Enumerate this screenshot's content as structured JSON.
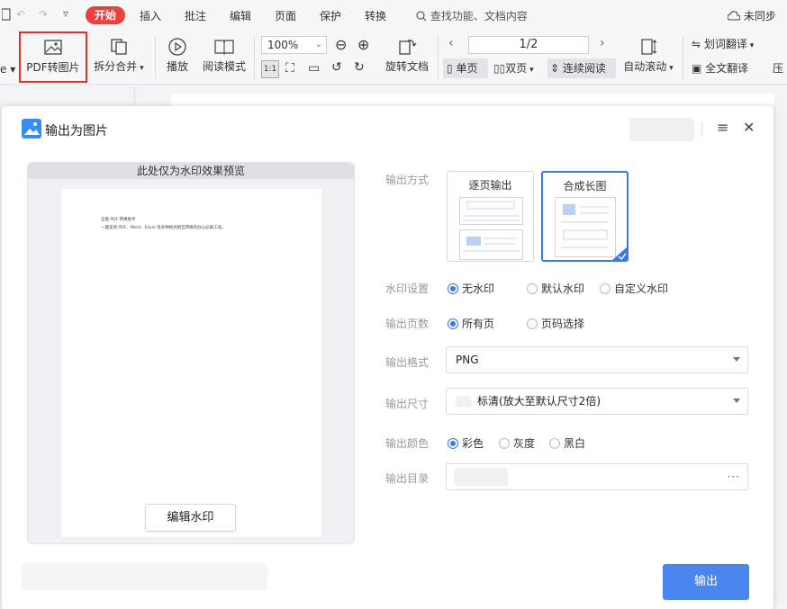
{
  "menubar": {
    "items": [
      "开始",
      "插入",
      "批注",
      "编辑",
      "页面",
      "保护",
      "转换"
    ],
    "search_placeholder": "查找功能、文档内容",
    "sync_label": "未同步"
  },
  "toolbar": {
    "pdf_to_image": "PDF转图片",
    "split_merge": "拆分合并",
    "play": "播放",
    "read_mode": "阅读模式",
    "zoom": "100%",
    "rotate_doc": "旋转文档",
    "page_indicator": "1/2",
    "single_page": "单页",
    "double_page": "双页",
    "continuous": "连续阅读",
    "auto_scroll": "自动滚动",
    "word_translate": "划词翻译",
    "full_translate": "全文翻译",
    "overflow": "压"
  },
  "dialog": {
    "title": "输出为图片",
    "preview_header": "此处仅为水印效果预览",
    "preview_line1": "全能 PDF 转换助手",
    "preview_line2": "一键支持 PDF、Word、Excel 等多种格式相互转换的办公必备工具。",
    "edit_watermark": "编辑水印",
    "output_mode_label": "输出方式",
    "mode_per_page": "逐页输出",
    "mode_long_image": "合成长图",
    "watermark_label": "水印设置",
    "wm_none": "无水印",
    "wm_default": "默认水印",
    "wm_custom": "自定义水印",
    "pages_label": "输出页数",
    "pages_all": "所有页",
    "pages_select": "页码选择",
    "format_label": "输出格式",
    "format_value": "PNG",
    "size_label": "输出尺寸",
    "size_value": "标清(放大至默认尺寸2倍)",
    "color_label": "输出颜色",
    "color_full": "彩色",
    "color_gray": "灰度",
    "color_bw": "黑白",
    "dir_label": "输出目录",
    "dir_more": "···",
    "export": "输出"
  },
  "colors": {
    "accent": "#3b78e7",
    "start_tab": "#e8413f",
    "highlight_border": "#e0302c",
    "export_button": "#4a86f0"
  }
}
